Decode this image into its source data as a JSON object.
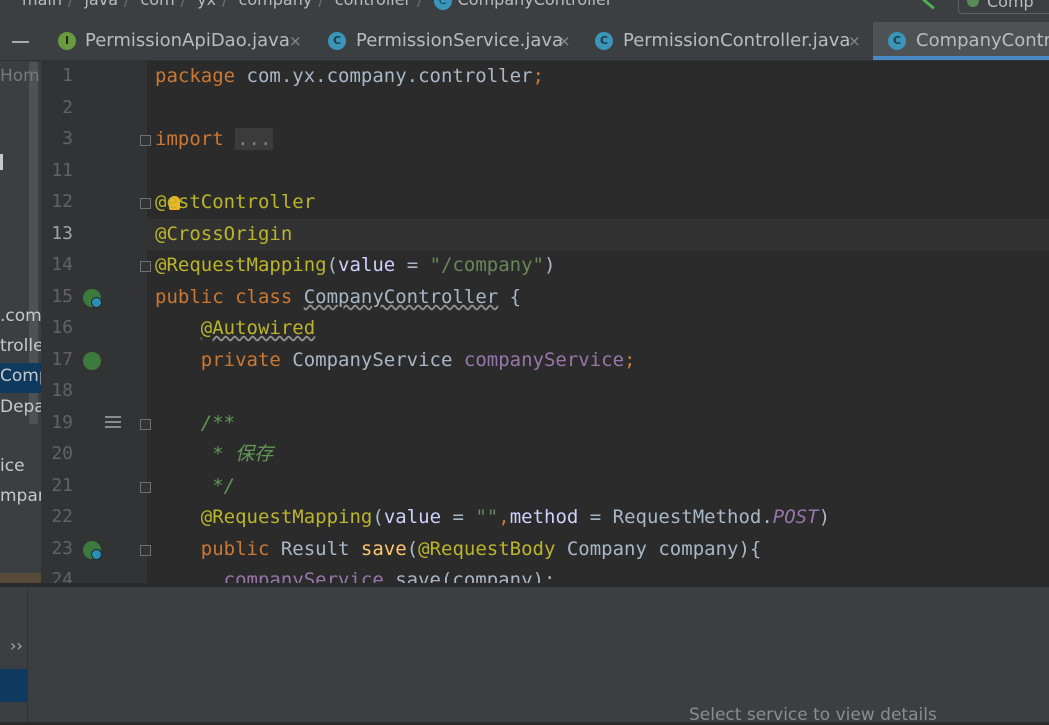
{
  "breadcrumb": {
    "items": [
      "main",
      "java",
      "com",
      "yx",
      "company",
      "controller"
    ],
    "current": "CompanyController"
  },
  "run_config": {
    "label": "Comp"
  },
  "project_panel": {
    "home_label": "Hom",
    "items": [
      ".com",
      "trolle",
      "Comp",
      "Depar",
      "ice",
      "mpany"
    ]
  },
  "tabs": [
    {
      "label": "PermissionApiDao.java",
      "icon": "interface-icon",
      "icon_glyph": "I",
      "close": "×"
    },
    {
      "label": "PermissionService.java",
      "icon": "class-icon",
      "icon_glyph": "C",
      "close": "×"
    },
    {
      "label": "PermissionController.java",
      "icon": "class-icon",
      "icon_glyph": "C",
      "close": "×"
    },
    {
      "label": "CompanyContro",
      "icon": "class-icon",
      "icon_glyph": "C",
      "active": true
    }
  ],
  "editor": {
    "line_numbers": [
      "1",
      "2",
      "3",
      "11",
      "12",
      "13",
      "14",
      "15",
      "16",
      "17",
      "18",
      "19",
      "20",
      "21",
      "22",
      "23",
      "24"
    ],
    "current_line": "13",
    "code": {
      "l1_kw": "package",
      "l1_rest": " com.yx.company.controller",
      "l1_semi": ";",
      "l3_kw": "import",
      "l3_fold": "...",
      "l12_at": "@",
      "l12_ann": "estController",
      "l13_ann": "@CrossOrigin",
      "l14_ann": "@RequestMapping",
      "l14_open": "(",
      "l14_param": "value",
      "l14_eq": " = ",
      "l14_str": "\"/company\"",
      "l14_close": ")",
      "l15_kw": "public class",
      "l15_name": "CompanyController",
      "l15_brace": " {",
      "l16_ann": "@Autowired",
      "l17_kw": "private",
      "l17_type": " CompanyService ",
      "l17_field": "companyService",
      "l17_semi": ";",
      "l19_cmt": "/**",
      "l20_cmt": " * 保存",
      "l21_cmt": " */",
      "l22_ann": "@RequestMapping",
      "l22_open": "(",
      "l22_p1": "value",
      "l22_eq1": " = ",
      "l22_str": "\"\"",
      "l22_comma": ",",
      "l22_p2": "method",
      "l22_eq2": " = RequestMethod.",
      "l22_const": "POST",
      "l22_close": ")",
      "l23_kw": "public",
      "l23_type": " Result ",
      "l23_method": "save",
      "l23_open": "(",
      "l23_ann": "@RequestBody",
      "l23_rest": " Company company){",
      "l24_field": "companyService",
      "l24_rest": ".save(company);"
    }
  },
  "bottom_panel": {
    "chevron": "››",
    "hint": "Select service to view details"
  },
  "colors": {
    "editor_bg": "#2b2b2b",
    "keyword": "#cc7832",
    "annotation": "#bbb529",
    "string": "#6a8759",
    "field": "#9876aa",
    "method": "#ffc66d",
    "comment": "#629755",
    "accent": "#4a88c7"
  }
}
